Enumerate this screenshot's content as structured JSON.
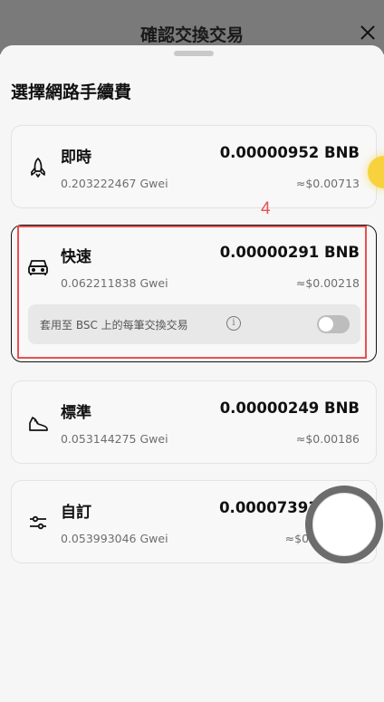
{
  "background": {
    "title": "確認交換交易"
  },
  "sheet": {
    "title": "選擇網路手續費"
  },
  "options": [
    {
      "name": "即時",
      "amount": "0.00000952 BNB",
      "gwei": "0.203222467 Gwei",
      "usd": "≈$0.00713",
      "icon": "rocket-icon"
    },
    {
      "name": "快速",
      "amount": "0.00000291 BNB",
      "gwei": "0.062211838 Gwei",
      "usd": "≈$0.00218",
      "icon": "car-icon",
      "selected": true,
      "apply_label": "套用至 BSC 上的每筆交換交易",
      "apply_toggle": false
    },
    {
      "name": "標準",
      "amount": "0.00000249 BNB",
      "gwei": "0.053144275 Gwei",
      "usd": "≈$0.00186",
      "icon": "sneaker-icon"
    },
    {
      "name": "自訂",
      "amount": "0.00007393 B",
      "gwei": "0.053993046 Gwei",
      "usd": "≈$0.",
      "icon": "sliders-icon"
    }
  ],
  "annotation": {
    "label": "4"
  },
  "colors": {
    "annotation": "#e8504f",
    "selected_border": "#111111"
  }
}
